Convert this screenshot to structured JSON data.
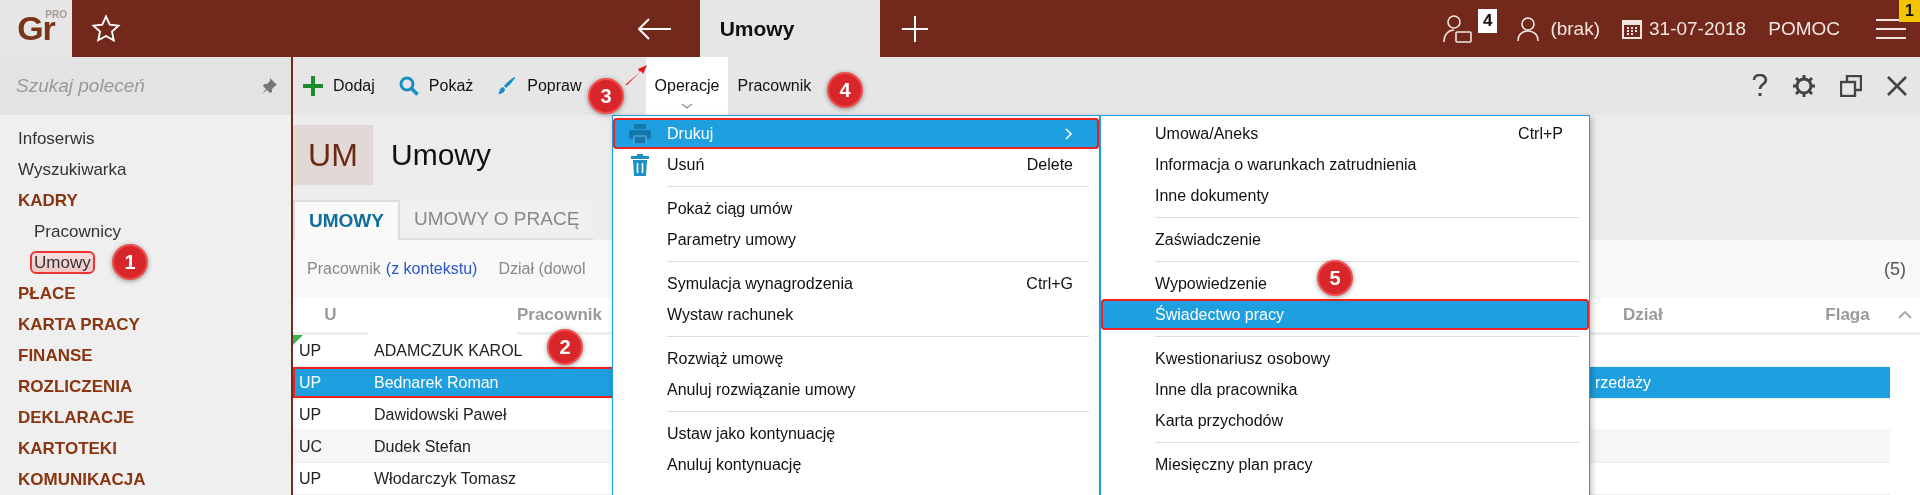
{
  "topbar": {
    "logo": "Gr",
    "logo_tag": "PRO",
    "tab": "Umowy",
    "counter_badge": "4",
    "user": "(brak)",
    "date": "31-07-2018",
    "help": "POMOC",
    "menu_badge": "1"
  },
  "sidebar": {
    "search_placeholder": "Szukaj poleceń",
    "items": [
      {
        "label": "Infoserwis",
        "kind": "link",
        "selected": false,
        "highlighted": false
      },
      {
        "label": "Wyszukiwarka",
        "kind": "link",
        "selected": false,
        "highlighted": false
      },
      {
        "label": "KADRY",
        "kind": "section",
        "selected": false,
        "highlighted": false,
        "children": [
          {
            "label": "Pracownicy",
            "kind": "link",
            "selected": false,
            "highlighted": false
          },
          {
            "label": "Umowy",
            "kind": "link",
            "selected": true,
            "highlighted": true
          }
        ]
      },
      {
        "label": "PŁACE",
        "kind": "section",
        "selected": false,
        "highlighted": false
      },
      {
        "label": "KARTA PRACY",
        "kind": "section",
        "selected": false,
        "highlighted": false
      },
      {
        "label": "FINANSE",
        "kind": "section",
        "selected": false,
        "highlighted": false
      },
      {
        "label": "ROZLICZENIA",
        "kind": "section",
        "selected": false,
        "highlighted": false
      },
      {
        "label": "DEKLARACJE",
        "kind": "section",
        "selected": false,
        "highlighted": false
      },
      {
        "label": "KARTOTEKI",
        "kind": "section",
        "selected": false,
        "highlighted": false
      },
      {
        "label": "KOMUNIKACJA",
        "kind": "section",
        "selected": false,
        "highlighted": false
      }
    ]
  },
  "toolbar": {
    "actions": [
      {
        "label": "Dodaj",
        "kind": "add"
      },
      {
        "label": "Pokaż",
        "kind": "view"
      },
      {
        "label": "Popraw",
        "kind": "edit"
      }
    ],
    "menus": [
      {
        "label": "Operacje",
        "selected": true
      },
      {
        "label": "Pracownik",
        "selected": false
      }
    ]
  },
  "page": {
    "code": "UM",
    "title": "Umowy"
  },
  "tabs": [
    {
      "label": "UMOWY",
      "selected": true
    },
    {
      "label": "UMOWY O PRACĘ",
      "selected": false
    }
  ],
  "filters": {
    "label": "Pracownik",
    "link": "(z kontekstu)",
    "second": "Dział (dowol",
    "count": "(5)"
  },
  "table": {
    "columns": [
      "U",
      "Pracownik",
      "Dział",
      "Flaga"
    ],
    "rows": [
      {
        "u": "UP",
        "employee": "ADAMCZUK KAROL",
        "flagged": true,
        "selected": false,
        "highlighted": false
      },
      {
        "u": "UP",
        "employee": "Bednarek Roman",
        "department": "rzedaży",
        "flagged": false,
        "selected": true,
        "highlighted": true
      },
      {
        "u": "UP",
        "employee": "Dawidowski Paweł",
        "flagged": false,
        "selected": false,
        "highlighted": false
      },
      {
        "u": "UC",
        "employee": "Dudek Stefan",
        "flagged": false,
        "selected": false,
        "highlighted": false
      },
      {
        "u": "UP",
        "employee": "Włodarczyk Tomasz",
        "flagged": false,
        "selected": false,
        "highlighted": false
      }
    ]
  },
  "context_menu": {
    "groups": [
      [
        {
          "label": "Drukuj",
          "kind": "print",
          "submenu": true,
          "selected": true,
          "highlighted": true
        },
        {
          "label": "Usuń",
          "kind": "delete",
          "shortcut": "Delete",
          "submenu": false,
          "selected": false,
          "highlighted": false
        }
      ],
      [
        {
          "label": "Pokaż ciąg umów",
          "kind": "plain",
          "submenu": false,
          "selected": false,
          "highlighted": false
        },
        {
          "label": "Parametry umowy",
          "kind": "plain",
          "submenu": false,
          "selected": false,
          "highlighted": false
        }
      ],
      [
        {
          "label": "Symulacja wynagrodzenia",
          "kind": "plain",
          "shortcut": "Ctrl+G",
          "submenu": false,
          "selected": false,
          "highlighted": false
        },
        {
          "label": "Wystaw rachunek",
          "kind": "plain",
          "submenu": false,
          "selected": false,
          "highlighted": false
        }
      ],
      [
        {
          "label": "Rozwiąż umowę",
          "kind": "plain",
          "submenu": false,
          "selected": false,
          "highlighted": false
        },
        {
          "label": "Anuluj rozwiązanie umowy",
          "kind": "plain",
          "submenu": false,
          "selected": false,
          "highlighted": false
        }
      ],
      [
        {
          "label": "Ustaw jako kontynuację",
          "kind": "plain",
          "submenu": false,
          "selected": false,
          "highlighted": false
        },
        {
          "label": "Anuluj kontynuację",
          "kind": "plain",
          "submenu": false,
          "selected": false,
          "highlighted": false
        }
      ]
    ]
  },
  "submenu": {
    "groups": [
      [
        {
          "label": "Umowa/Aneks",
          "kind": "plain",
          "shortcut": "Ctrl+P",
          "submenu": false,
          "selected": false,
          "highlighted": false
        },
        {
          "label": "Informacja o warunkach zatrudnienia",
          "kind": "plain",
          "submenu": false,
          "selected": false,
          "highlighted": false
        },
        {
          "label": "Inne dokumenty",
          "kind": "plain",
          "submenu": false,
          "selected": false,
          "highlighted": false
        }
      ],
      [
        {
          "label": "Zaświadczenie",
          "kind": "plain",
          "submenu": false,
          "selected": false,
          "highlighted": false
        }
      ],
      [
        {
          "label": "Wypowiedzenie",
          "kind": "plain",
          "submenu": false,
          "selected": false,
          "highlighted": false
        },
        {
          "label": "Świadectwo pracy",
          "kind": "plain",
          "submenu": false,
          "selected": true,
          "highlighted": true
        }
      ],
      [
        {
          "label": "Kwestionariusz osobowy",
          "kind": "plain",
          "submenu": false,
          "selected": false,
          "highlighted": false
        },
        {
          "label": "Inne dla pracownika",
          "kind": "plain",
          "submenu": false,
          "selected": false,
          "highlighted": false
        },
        {
          "label": "Karta przychodów",
          "kind": "plain",
          "submenu": false,
          "selected": false,
          "highlighted": false
        }
      ],
      [
        {
          "label": "Miesięczny plan pracy",
          "kind": "plain",
          "submenu": false,
          "selected": false,
          "highlighted": false
        }
      ]
    ]
  },
  "annotations": [
    {
      "label": "1"
    },
    {
      "label": "2"
    },
    {
      "label": "3"
    },
    {
      "label": "4"
    },
    {
      "label": "5"
    }
  ]
}
